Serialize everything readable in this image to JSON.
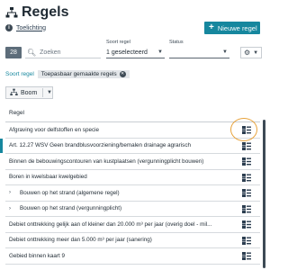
{
  "page": {
    "title": "Regels",
    "explain_link": "Toelichting",
    "new_button": "Nieuwe regel"
  },
  "filters": {
    "count": "28",
    "search_placeholder": "Zoeken",
    "type_label": "Soort regel",
    "type_value": "1 geselecteerd",
    "status_label": "Status",
    "status_value": ""
  },
  "sort": {
    "label": "Soort regel",
    "chip": "Toepasbaar gemaakte regels"
  },
  "view": {
    "label": "Boom"
  },
  "table": {
    "column": "Regel",
    "rows": [
      {
        "text": "Afgraving voor delfstoffen en specie",
        "expandable": false,
        "selected": false
      },
      {
        "text": "Art. 12.27 WSV Geen brandblusvoorziening/bemalen drainage agrarisch",
        "expandable": false,
        "selected": true
      },
      {
        "text": "Binnen de bebouwingscontouren van kustplaatsen (vergunningplicht bouwen)",
        "expandable": false,
        "selected": false
      },
      {
        "text": "Boren in kwelsbaar kwelgebied",
        "expandable": false,
        "selected": false
      },
      {
        "text": "Bouwen op het strand (algemene regel)",
        "expandable": true,
        "selected": false
      },
      {
        "text": "Bouwen op het strand (vergunningplicht)",
        "expandable": true,
        "selected": false
      },
      {
        "text": "Debiet onttrekking gelijk aan of kleiner dan 20.000 m³ per jaar (overig doel - mil...",
        "expandable": false,
        "selected": false
      },
      {
        "text": "Debiet onttrekking meer dan 5.000 m³ per jaar (sanering)",
        "expandable": false,
        "selected": false
      },
      {
        "text": "Gebied binnen kaart 9",
        "expandable": false,
        "selected": false
      }
    ]
  },
  "colors": {
    "accent": "#16879e",
    "highlight": "#e8a33b"
  }
}
